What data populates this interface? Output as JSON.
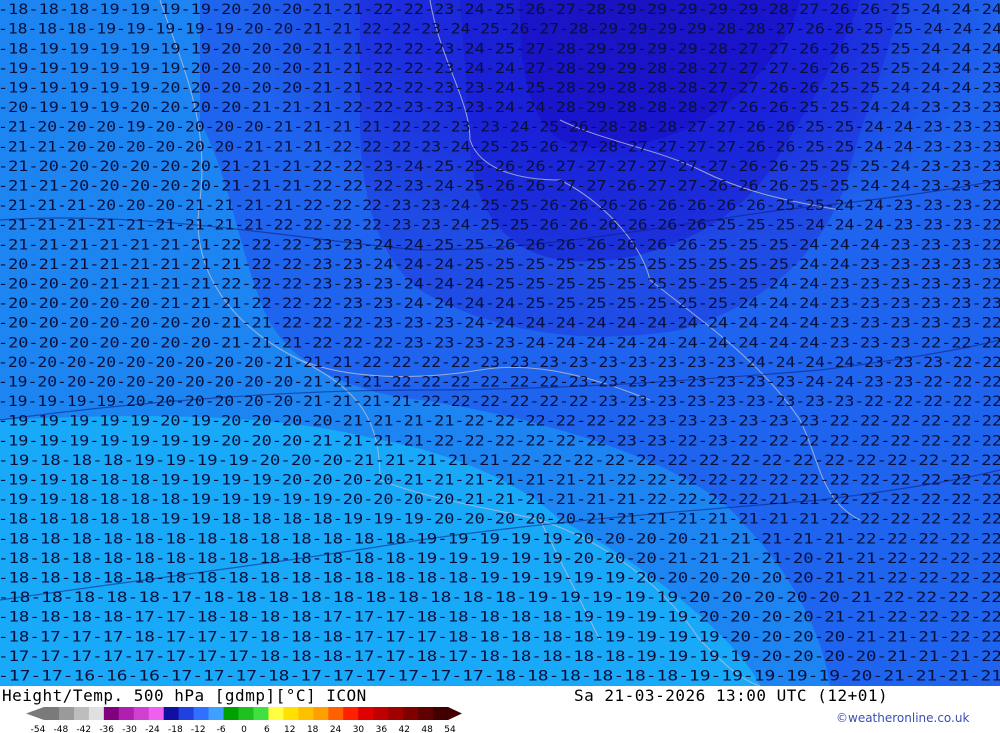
{
  "header": {
    "title": "Height/Temp. 500 hPa [gdmp][°C] ICON",
    "datetime": "Sa 21-03-2026 13:00 UTC (12+01)",
    "credit": "©weatheronline.co.uk"
  },
  "legend": {
    "ticks": [
      "-54",
      "-48",
      "-42",
      "-36",
      "-30",
      "-24",
      "-18",
      "-12",
      "-6",
      "0",
      "6",
      "12",
      "18",
      "24",
      "30",
      "36",
      "42",
      "48",
      "54"
    ],
    "colors": [
      "#7a7a7a",
      "#9a9a9a",
      "#bdbdbd",
      "#e0e0e0",
      "#800080",
      "#b020b0",
      "#d040d0",
      "#f060f0",
      "#1010a0",
      "#2040e0",
      "#3070ff",
      "#40a0ff",
      "#00a000",
      "#20c020",
      "#40e040",
      "#ffff40",
      "#ffe000",
      "#ffc000",
      "#ffa000",
      "#ff6000",
      "#ff2000",
      "#e00000",
      "#c00000",
      "#a00000",
      "#800000",
      "#600000",
      "#400000"
    ]
  },
  "map": {
    "type": "temperature-contour-map",
    "level": "500 hPa",
    "unit": "°C",
    "rows": [
      "-18-18-18-19-19-19-19-20-20-20-21-21-22-22-23-24-25-26-27-28-29-29-29-29-29-28-27-26-26-25-24-24-24",
      "-18-18-18-19-19-19-19-19-20-20-21-21-22-22-23-24-25-26-27-28-29-29-29-29-28-28-27-26-26-25-25-24-24-24",
      "-18-19-19-19-19-19-19-20-20-20-21-21-22-22-23-24-25-27-28-29-29-29-29-28-27-27-26-26-25-25-24-24-24",
      "-19-19-19-19-19-19-20-20-20-20-21-21-22-22-23-24-24-27-28-29-29-28-28-27-27-27-26-26-25-25-24-24-23",
      "-19-19-19-19-19-20-20-20-20-20-21-21-22-22-23-23-24-25-28-29-28-28-28-27-27-26-26-25-25-24-24-24-23",
      "-20-19-19-19-20-20-20-20-21-21-21-22-22-23-23-23-24-24-28-29-28-28-28-27-26-26-25-25-24-24-23-23-23",
      "-21-20-20-20-19-20-20-20-20-21-21-21-21-22-22-23-23-24-25-26-28-28-28-27-27-26-26-25-25-24-24-23-23-23",
      "-21-21-20-20-20-20-20-20-21-21-21-22-22-22-23-24-25-25-26-27-28-27-27-27-27-26-26-25-25-24-24-23-23-23",
      "-21-20-20-20-20-20-20-21-21-21-22-22-23-24-25-25-26-26-27-27-27-27-27-27-26-26-25-25-25-24-23-23-23",
      "-21-21-20-20-20-20-20-21-21-21-22-22-22-23-24-25-26-26-27-27-26-27-27-26-26-26-25-25-24-24-23-23-23",
      "-21-21-21-20-20-20-21-21-21-21-22-22-22-23-23-24-25-25-26-26-26-26-26-26-26-26-25-25-24-24-23-23-23-22",
      "-21-21-21-21-21-21-21-21-21-22-22-22-22-23-23-24-25-25-26-26-26-26-26-26-25-25-25-24-24-24-23-23-23-22",
      "-21-21-21-21-21-21-21-22-22-22-23-23-24-24-25-25-26-26-26-26-26-26-26-25-25-25-24-24-24-23-23-23-22",
      "-20-21-21-21-21-21-21-21-22-22-23-23-24-24-24-25-25-25-25-25-25-25-25-25-25-25-24-24-23-23-23-23-23",
      "-20-20-20-21-21-21-21-22-22-22-23-23-23-24-24-24-25-25-25-25-25-25-25-25-25-24-24-23-23-23-23-23-22",
      "-20-20-20-20-20-21-21-21-22-22-22-23-23-24-24-24-24-25-25-25-25-25-25-25-24-24-24-23-23-23-23-23-23",
      "-20-20-20-20-20-20-20-21-21-22-22-22-23-23-23-24-24-24-24-24-24-24-24-24-24-24-24-23-23-23-23-23-22",
      "-20-20-20-20-20-20-20-21-21-21-22-22-22-23-23-23-23-24-24-24-24-24-24-24-24-24-24-23-23-23-22-22-22",
      "-20-20-20-20-20-20-20-20-20-21-21-21-22-22-22-22-23-23-23-23-23-23-23-23-23-24-24-24-24-23-23-23-22-22",
      "-19-20-20-20-20-20-20-20-20-20-21-21-21-22-22-22-22-22-22-23-23-23-23-23-23-23-23-24-24-23-23-22-22-22",
      "-19-19-19-19-20-20-20-20-20-20-21-21-21-21-22-22-22-22-22-22-23-23-23-23-23-23-23-23-23-22-22-22-22-22",
      "-19-19-19-19-19-20-19-20-20-20-20-21-21-21-21-22-22-22-22-22-22-23-23-23-23-23-23-22-22-22-22-22-22",
      "-19-19-19-19-19-19-19-20-20-20-21-21-21-21-22-22-22-22-22-22-23-23-22-23-22-22-22-22-22-22-22-22-22",
      "-19-18-18-18-19-19-19-19-20-20-20-21-21-21-21-21-22-22-22-22-22-22-22-22-22-22-22-22-22-22-22-22",
      "-19-19-18-18-18-19-19-19-19-20-20-20-20-21-21-21-21-21-21-21-22-22-22-22-22-22-22-22-22-22-22-22-22",
      "-19-19-18-18-18-18-19-19-19-19-19-20-20-20-20-21-21-21-21-21-21-22-22-22-22-21-21-22-22-22-22-22-22",
      "-18-18-18-18-18-19-19-18-18-18-18-19-19-19-20-20-20-20-20-21-21-21-21-21-21-21-21-22-22-22-22-22-22",
      "-18-18-18-18-18-18-18-18-18-18-18-18-18-19-19-19-19-19-20-20-20-20-21-21-21-21-21-22-22-22-22-22",
      "-18-18-18-18-18-18-18-18-18-18-18-18-18-19-19-19-19-19-20-20-20-21-21-21-21-20-21-21-22-22-22-22",
      "-18-18-18-18-18-18-18-18-18-18-18-18-18-18-18-19-19-19-19-19-20-20-20-20-20-20-21-21-22-22-22-22",
      "-18-18-18-18-18-17-18-18-18-18-18-18-18-18-18-18-19-19-19-19-19-20-20-20-20-20-21-22-22-22-22",
      "-18-18-18-18-17-17-18-18-18-18-17-17-17-18-18-18-18-18-19-19-19-19-20-20-20-20-21-21-22-22-22-22",
      "-18-17-17-17-18-17-17-17-18-18-18-17-17-17-18-18-18-18-18-19-19-19-19-20-20-20-20-21-21-21-22-22",
      "-17-17-17-17-17-17-17-17-18-18-18-17-17-18-17-18-18-18-18-18-19-19-19-19-20-20-20-20-21-21-21-22",
      "-17-17-16-16-16-17-17-17-18-17-17-17-17-17-17-18-18-18-18-18-18-19-19-19-19-19-20-21-21-21-21"
    ]
  }
}
